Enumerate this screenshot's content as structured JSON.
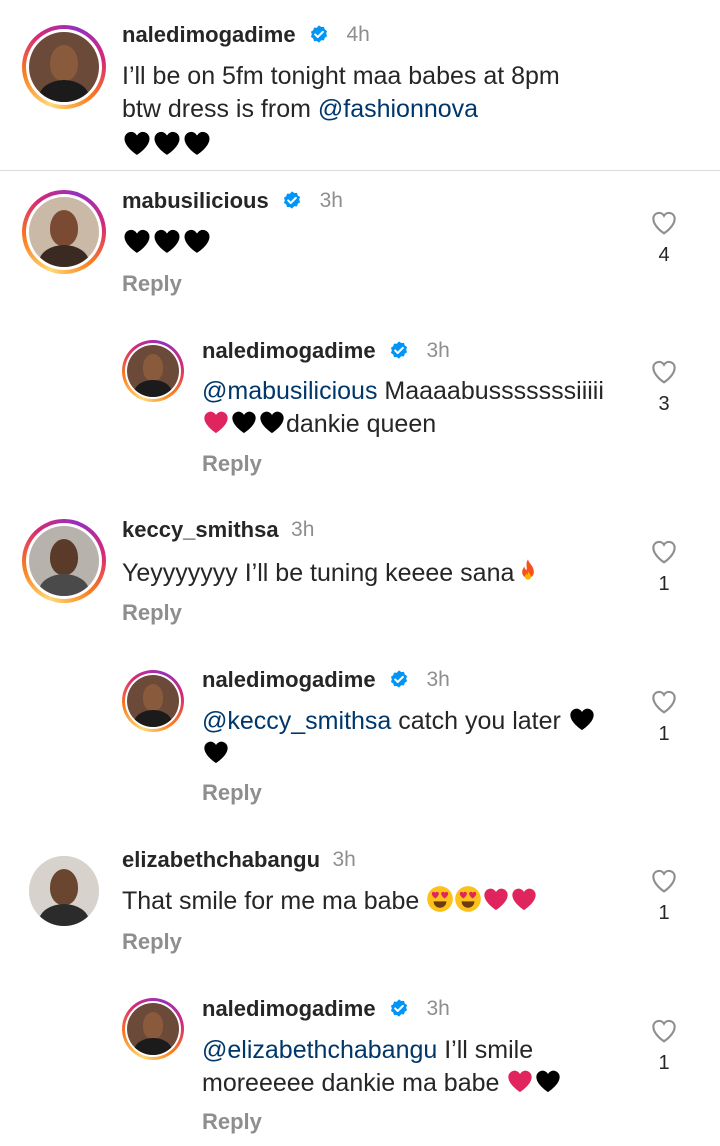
{
  "caption": {
    "username": "naledimogadime",
    "time": "4h",
    "line1": "I’ll be on 5fm tonight maa babes at 8pm",
    "line2_prefix": "btw dress is from ",
    "line2_mention": "@fashionnova",
    "emoji_icons": [
      "black-heart-icon",
      "black-heart-icon",
      "black-heart-icon"
    ]
  },
  "comments": [
    {
      "username": "mabusilicious",
      "time": "3h",
      "verified": true,
      "emoji_icons": [
        "black-heart-icon",
        "black-heart-icon",
        "black-heart-icon"
      ],
      "reply_label": "Reply",
      "likes": "4"
    },
    {
      "username": "naledimogadime",
      "time": "3h",
      "verified": true,
      "mention": "@mabusilicious",
      "text_line1": " Maaaabusssssssiiiii",
      "text_line2": "dankie queen",
      "reply_label": "Reply",
      "likes": "3"
    },
    {
      "username": "keccy_smithsa",
      "time": "3h",
      "verified": false,
      "text": "Yeyyyyyyy I’ll be tuning keeee sana",
      "reply_label": "Reply",
      "likes": "1"
    },
    {
      "username": "naledimogadime",
      "time": "3h",
      "verified": true,
      "mention": "@keccy_smithsa",
      "text_line1": " catch you later",
      "reply_label": "Reply",
      "likes": "1"
    },
    {
      "username": "elizabethchabangu",
      "time": "3h",
      "verified": false,
      "text": "That smile for me ma babe ",
      "reply_label": "Reply",
      "likes": "1"
    },
    {
      "username": "naledimogadime",
      "time": "3h",
      "verified": true,
      "mention": "@elizabethchabangu",
      "text_line1": " I’ll smile",
      "text_line2": "moreeeee dankie ma babe ",
      "reply_label": "Reply",
      "likes": "1"
    }
  ],
  "colors": {
    "text": "#262626",
    "secondary": "#8e8e8e",
    "mention": "#00376b",
    "verified": "#0095f6",
    "heart_red": "#e0245e",
    "black_heart": "#000000"
  }
}
